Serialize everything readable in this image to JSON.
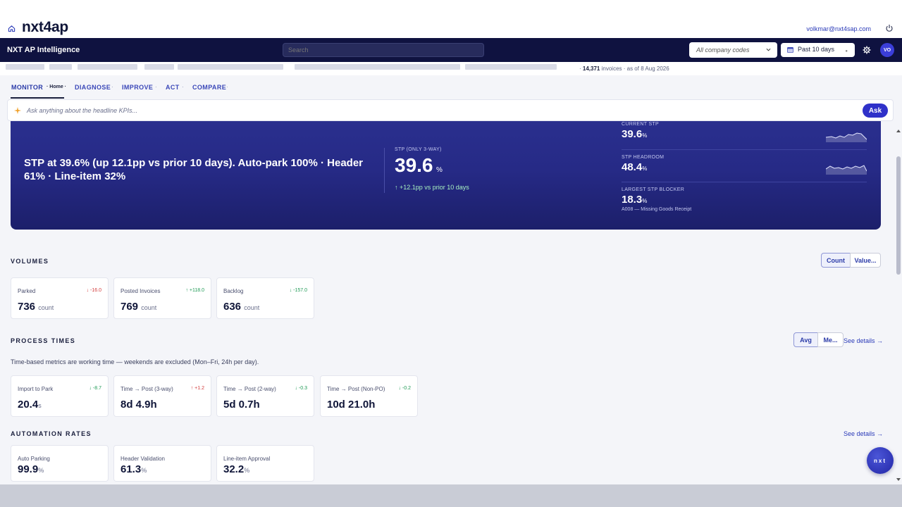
{
  "brand": {
    "logo_text": "nxt4ap",
    "user_email": "volkmar@nxt4sap.com"
  },
  "navbar": {
    "app_title": "NXT AP Intelligence",
    "search_placeholder": "Search",
    "company_filter": "All company codes",
    "period_filter": "Past 10 days",
    "avatar_initials": "VO"
  },
  "strip": {
    "invoice_count": "14,371",
    "invoice_suffix": "invoices · as of 8 Aug 2026",
    "prefix": "·"
  },
  "tabs": [
    {
      "label": "MONITOR",
      "sub": "Home"
    },
    {
      "label": "DIAGNOSE"
    },
    {
      "label": "IMPROVE"
    },
    {
      "label": "ACT"
    },
    {
      "label": "COMPARE"
    }
  ],
  "tab_separator": "·",
  "ask": {
    "placeholder": "Ask anything about the headline KPIs...",
    "button": "Ask"
  },
  "hero": {
    "headline": "STP at 39.6% (up 12.1pp vs prior 10 days). Auto-park 100% · Header 61% · Line-item 32%",
    "stp_label": "STP (ONLY 3-WAY)",
    "stp_value": "39.6",
    "stp_unit": "%",
    "stp_delta": "↑ +12.1pp vs prior 10 days",
    "side": [
      {
        "label": "CURRENT STP",
        "value": "39.6",
        "unit": "%"
      },
      {
        "label": "STP HEADROOM",
        "value": "48.4",
        "unit": "%"
      },
      {
        "label": "LARGEST STP BLOCKER",
        "value": "18.3",
        "unit": "%",
        "sub": "A008 — Missing Goods Receipt"
      }
    ]
  },
  "volumes": {
    "title": "VOLUMES",
    "toggle": [
      "Count",
      "Value..."
    ],
    "cards": [
      {
        "label": "Parked",
        "delta": "↓ -16.0",
        "value": "736",
        "unit": "count",
        "trend": "neg"
      },
      {
        "label": "Posted Invoices",
        "delta": "↑ +118.0",
        "value": "769",
        "unit": "count",
        "trend": "pos"
      },
      {
        "label": "Backlog",
        "delta": "↓ -157.0",
        "value": "636",
        "unit": "count",
        "trend": "pos"
      }
    ]
  },
  "process": {
    "title": "PROCESS TIMES",
    "toggle": [
      "Avg",
      "Me..."
    ],
    "see_details": "See details →",
    "note": "Time-based metrics are working time — weekends are excluded (Mon–Fri, 24h per day).",
    "cards": [
      {
        "label": "Import to Park",
        "delta": "↓ -8.7",
        "value": "20.4",
        "unit": "s",
        "trend": "pos"
      },
      {
        "label": "Time → Post (3-way)",
        "delta": "↑ +1.2",
        "value": "8d 4.9h",
        "unit": "",
        "trend": "neg"
      },
      {
        "label": "Time → Post (2-way)",
        "delta": "↓ -0.3",
        "value": "5d 0.7h",
        "unit": "",
        "trend": "pos"
      },
      {
        "label": "Time → Post (Non-PO)",
        "delta": "↓ -0.2",
        "value": "10d 21.0h",
        "unit": "",
        "trend": "pos"
      }
    ]
  },
  "automation": {
    "title": "AUTOMATION RATES",
    "see_details": "See details →",
    "cards": [
      {
        "label": "Auto Parking",
        "value": "99.9",
        "unit": "%"
      },
      {
        "label": "Header Validation",
        "value": "61.3",
        "unit": "%"
      },
      {
        "label": "Line-item Approval",
        "value": "32.2",
        "unit": "%"
      }
    ]
  },
  "fab_label": "nxt",
  "colors": {
    "navy": "#0f1240",
    "accent": "#2f31c9",
    "hero": "#262a86",
    "negative": "#d23a3a",
    "positive": "#1f9a55"
  }
}
